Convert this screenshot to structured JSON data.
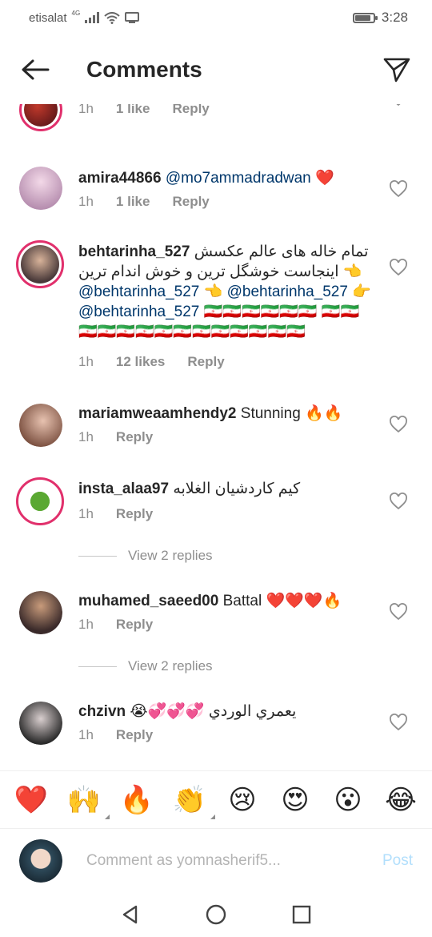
{
  "status_bar": {
    "carrier": "etisalat",
    "network": "4G",
    "time": "3:28"
  },
  "header": {
    "title": "Comments"
  },
  "comments": [
    {
      "username": "",
      "text": "",
      "time": "1h",
      "likes": "1 like",
      "reply": "Reply"
    },
    {
      "username": "amira44866",
      "mention": "@mo7ammadradwan",
      "text": "❤️",
      "time": "1h",
      "likes": "1 like",
      "reply": "Reply"
    },
    {
      "username": "behtarinha_527",
      "text_rtl": "تمام خاله های عالم عکسش اینجاست خوشگل ترین و خوش اندام ترین",
      "emoji_point": "👈",
      "mention": "@behtarinha_527",
      "emoji_point2": "👈",
      "emoji_point3": "👉",
      "flags_line1": "🇮🇷🇮🇷🇮🇷🇮🇷🇮🇷🇮🇷",
      "flags_line2": "🇮🇷🇮🇷🇮🇷🇮🇷🇮🇷🇮🇷🇮🇷🇮🇷🇮🇷🇮🇷🇮🇷🇮🇷🇮🇷🇮🇷",
      "time": "1h",
      "likes": "12 likes",
      "reply": "Reply"
    },
    {
      "username": "mariamweaamhendy2",
      "text": "Stunning 🔥🔥",
      "time": "1h",
      "reply": "Reply"
    },
    {
      "username": "insta_alaa97",
      "text": "كيم كاردشيان الغلابه",
      "time": "1h",
      "reply": "Reply",
      "view_replies": "View 2 replies"
    },
    {
      "username": "muhamed_saeed00",
      "text": "Battal ❤️❤️❤️🔥",
      "time": "1h",
      "reply": "Reply",
      "view_replies": "View 2 replies"
    },
    {
      "username": "chzivn",
      "text": "يعمري الوردي 💞💞💞😭",
      "time": "1h",
      "reply": "Reply"
    }
  ],
  "emoji_bar": [
    "❤️",
    "🙌",
    "🔥",
    "👏",
    "😢",
    "😍",
    "😮",
    "😂"
  ],
  "composer": {
    "placeholder": "Comment as yomnasherif5...",
    "post_label": "Post"
  },
  "colors": {
    "text": "#262626",
    "secondary": "#8e8e8e",
    "mention": "#00376b",
    "story_ring": "#e1306c",
    "post_disabled": "#b2dffc"
  },
  "icons": {
    "back": "arrow-left-icon",
    "send": "paper-plane-icon",
    "like": "heart-outline-icon",
    "nav_back": "triangle-back-icon",
    "nav_home": "circle-home-icon",
    "nav_recent": "square-recent-icon"
  }
}
